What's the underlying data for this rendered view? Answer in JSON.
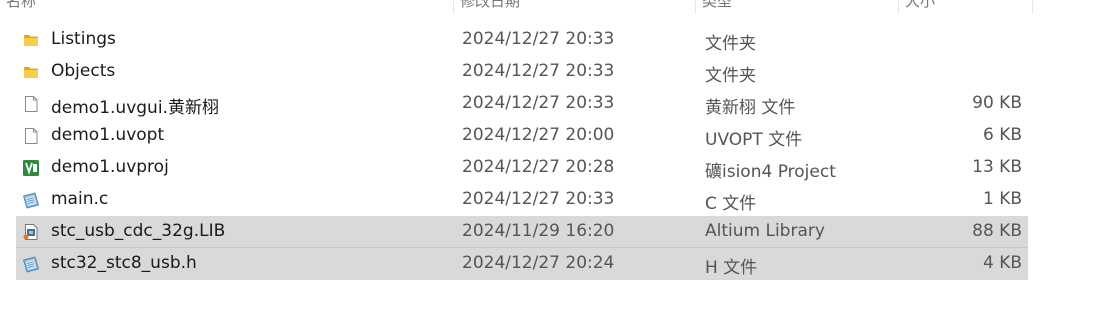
{
  "columns": [
    "名称",
    "修改日期",
    "类型",
    "大小"
  ],
  "files": [
    {
      "name": "Listings",
      "date": "2024/12/27 20:33",
      "type": "文件夹",
      "size": "",
      "icon": "folder-icon",
      "selected": false
    },
    {
      "name": "Objects",
      "date": "2024/12/27 20:33",
      "type": "文件夹",
      "size": "",
      "icon": "folder-icon",
      "selected": false
    },
    {
      "name": "demo1.uvgui.黄新栩",
      "date": "2024/12/27 20:33",
      "type": "黄新栩 文件",
      "size": "90 KB",
      "icon": "blank-file-icon",
      "selected": false
    },
    {
      "name": "demo1.uvopt",
      "date": "2024/12/27 20:00",
      "type": "UVOPT 文件",
      "size": "6 KB",
      "icon": "blank-file-icon",
      "selected": false
    },
    {
      "name": "demo1.uvproj",
      "date": "2024/12/27 20:28",
      "type": "礦ision4 Project",
      "size": "13 KB",
      "icon": "keil-project-icon",
      "selected": false
    },
    {
      "name": "main.c",
      "date": "2024/12/27 20:33",
      "type": "C 文件",
      "size": "1 KB",
      "icon": "source-file-icon",
      "selected": false
    },
    {
      "name": "stc_usb_cdc_32g.LIB",
      "date": "2024/11/29 16:20",
      "type": "Altium Library",
      "size": "88 KB",
      "icon": "library-file-icon",
      "selected": true
    },
    {
      "name": "stc32_stc8_usb.h",
      "date": "2024/12/27 20:24",
      "type": "H 文件",
      "size": "4 KB",
      "icon": "source-file-icon",
      "selected": true
    }
  ],
  "colors": {
    "folder": "#f3c43a",
    "selected_row": "#d9d9d9",
    "keil_green": "#2e8b3e"
  }
}
